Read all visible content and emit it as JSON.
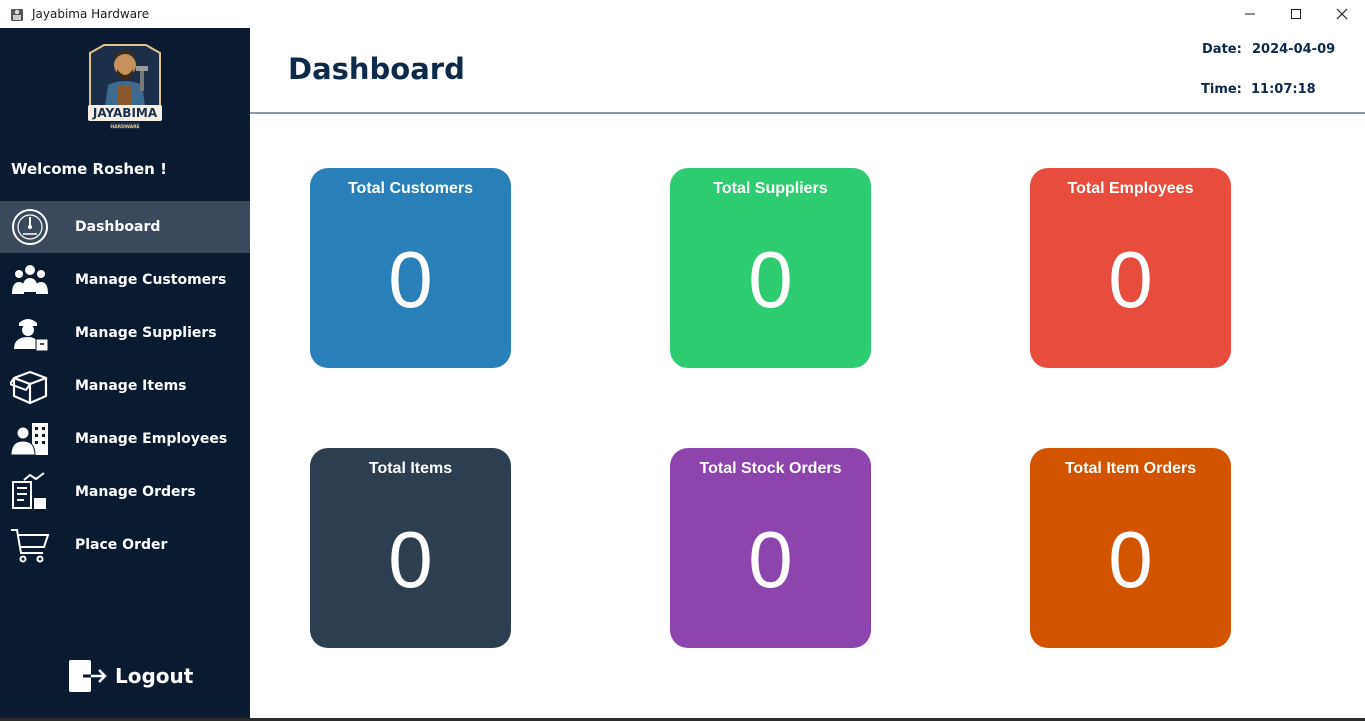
{
  "window": {
    "title": "Jayabima Hardware"
  },
  "sidebar": {
    "logo": {
      "name": "JAYABIMA",
      "sub": "HARDWARE"
    },
    "welcome": "Welcome Roshen !",
    "items": [
      {
        "label": "Dashboard",
        "icon": "dashboard-gauge-icon",
        "active": true
      },
      {
        "label": "Manage Customers",
        "icon": "customers-icon"
      },
      {
        "label": "Manage Suppliers",
        "icon": "supplier-icon"
      },
      {
        "label": "Manage Items",
        "icon": "box-icon"
      },
      {
        "label": "Manage Employees",
        "icon": "employees-icon"
      },
      {
        "label": "Manage Orders",
        "icon": "orders-icon"
      },
      {
        "label": "Place Order",
        "icon": "cart-icon"
      }
    ],
    "logout_label": "Logout"
  },
  "header": {
    "title": "Dashboard",
    "date_label": "Date:",
    "date_value": "2024-04-09",
    "time_label": "Time:",
    "time_value": "11:07:18"
  },
  "cards": [
    {
      "title": "Total Customers",
      "value": "0",
      "color": "#2980b9"
    },
    {
      "title": "Total Suppliers",
      "value": "0",
      "color": "#2ecc71"
    },
    {
      "title": "Total Employees",
      "value": "0",
      "color": "#e74c3c"
    },
    {
      "title": "Total Items",
      "value": "0",
      "color": "#2c3e50"
    },
    {
      "title": "Total Stock Orders",
      "value": "0",
      "color": "#8e44ad"
    },
    {
      "title": "Total Item Orders",
      "value": "0",
      "color": "#d35400"
    }
  ]
}
